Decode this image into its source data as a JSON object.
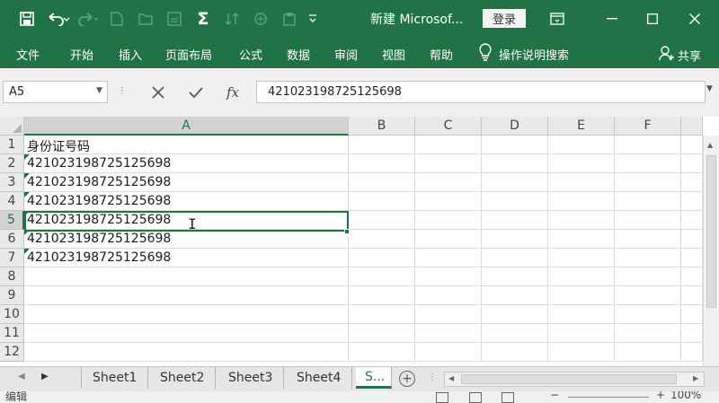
{
  "titlebar": {
    "doc_title": "新建 Microsof...",
    "login_label": "登录"
  },
  "ribbon": {
    "tabs": [
      "文件",
      "开始",
      "插入",
      "页面布局",
      "公式",
      "数据",
      "审阅",
      "视图",
      "帮助"
    ],
    "tell_me": "操作说明搜索",
    "share": "共享"
  },
  "formula_bar": {
    "name_box": "A5",
    "formula_value": "421023198725125698"
  },
  "grid": {
    "columns": [
      "A",
      "B",
      "C",
      "D",
      "E",
      "F"
    ],
    "rows": [
      "1",
      "2",
      "3",
      "4",
      "5",
      "6",
      "7",
      "8",
      "9",
      "10",
      "11",
      "12"
    ],
    "cells_a": [
      "身份证号码",
      "421023198725125698",
      "421023198725125698",
      "421023198725125698",
      "421023198725125698",
      "421023198725125698",
      "421023198725125698"
    ],
    "active_cell": "A5"
  },
  "sheets": {
    "tabs": [
      "Sheet1",
      "Sheet2",
      "Sheet3",
      "Sheet4",
      "S..."
    ],
    "active_index": 4
  },
  "statusbar": {
    "mode": "编辑",
    "zoom": "100%"
  },
  "colors": {
    "accent": "#217346",
    "error_indicator": "#1e7145"
  }
}
